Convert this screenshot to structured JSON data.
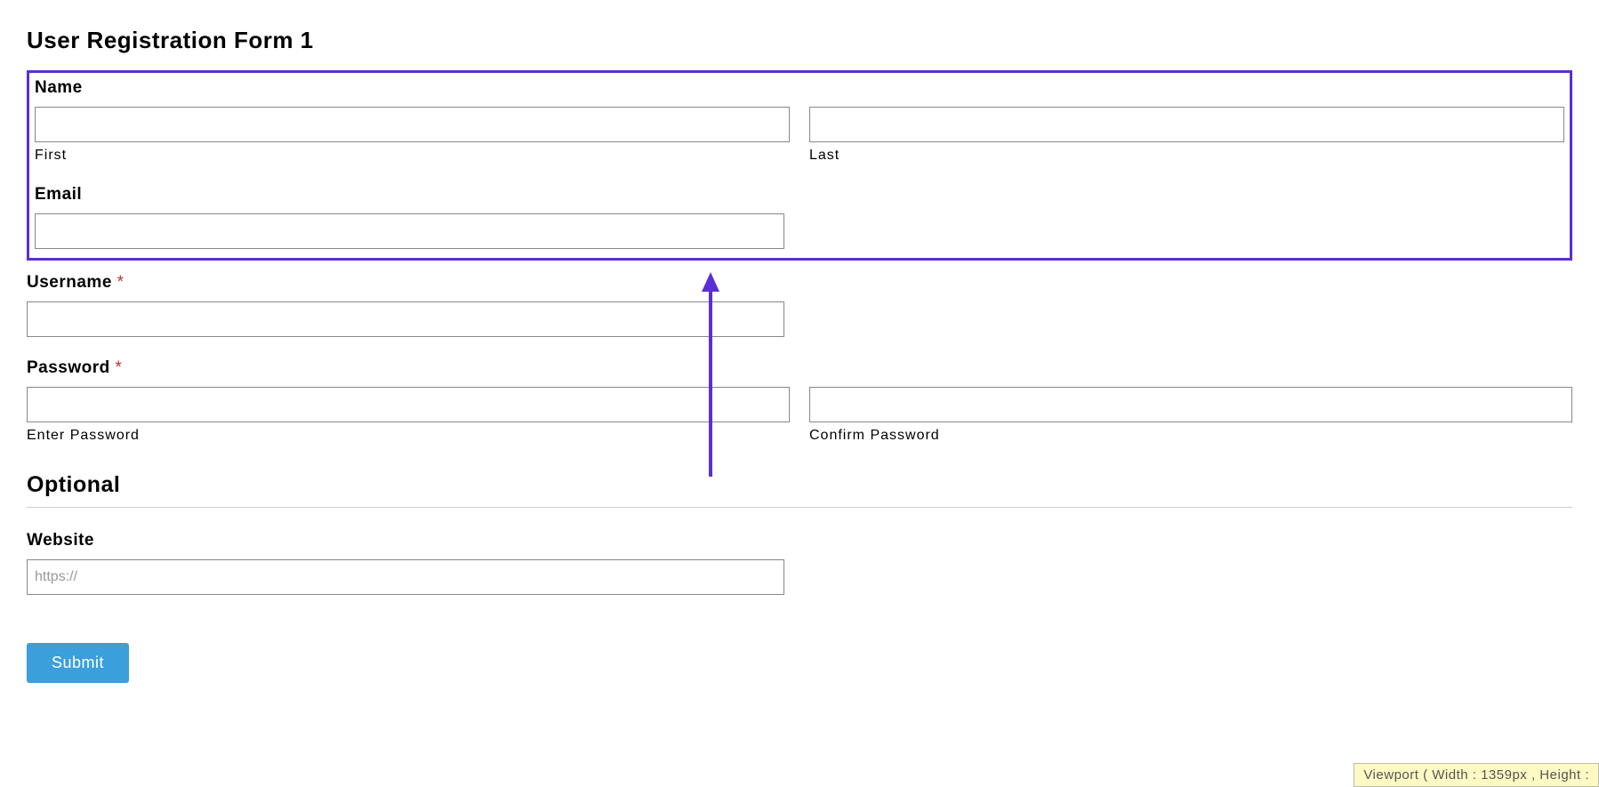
{
  "title": "User Registration Form 1",
  "fields": {
    "name": {
      "label": "Name",
      "first": {
        "value": "",
        "sub": "First"
      },
      "last": {
        "value": "",
        "sub": "Last"
      }
    },
    "email": {
      "label": "Email",
      "value": ""
    },
    "username": {
      "label": "Username",
      "required": "*",
      "value": ""
    },
    "password": {
      "label": "Password",
      "required": "*",
      "enter": {
        "value": "",
        "sub": "Enter Password"
      },
      "confirm": {
        "value": "",
        "sub": "Confirm Password"
      }
    },
    "website": {
      "label": "Website",
      "placeholder": "https://",
      "value": ""
    }
  },
  "section_optional": "Optional",
  "submit_label": "Submit",
  "viewport_text": "Viewport ( Width : 1359px , Height :"
}
